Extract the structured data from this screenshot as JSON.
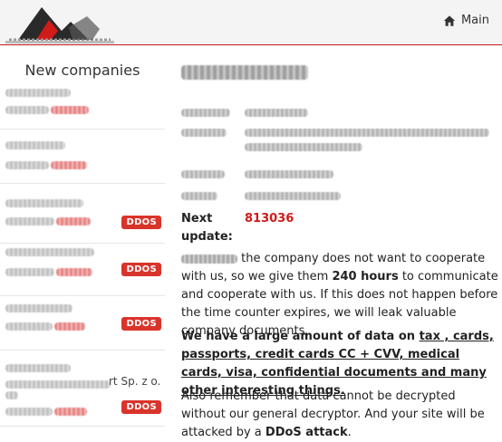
{
  "header": {
    "nav_main_label": "Main",
    "home_icon": "home-icon",
    "accent_color": "#c61a1a"
  },
  "sidebar": {
    "title": "New companies",
    "items": [
      {
        "ddos": false
      },
      {
        "ddos": false
      },
      {
        "ddos": true,
        "badge": "DDOS"
      },
      {
        "ddos": true,
        "badge": "DDOS"
      },
      {
        "ddos": true,
        "badge": "DDOS"
      },
      {
        "ddos": true,
        "badge": "DDOS",
        "tail_text": "rt Sp. z o."
      }
    ]
  },
  "main": {
    "next_update_label": "Next update:",
    "next_update_value": "813036",
    "paragraph1_part1": " the company does not want to cooperate with us, so we give them ",
    "paragraph1_hours": "240 hours",
    "paragraph1_part2": " to communicate and cooperate with us. If this does not happen before the time counter expires, we will leak valuable company documents.",
    "paragraph2_lead": "We have a large amount of data on ",
    "paragraph2_list": "tax , cards, passports, credit cards CC + CVV, medical cards, visa, confidential documents and many other interesting things.",
    "paragraph3_part1": "Also remember that data cannot be decrypted without our general decryptor. And your site will be attacked by a ",
    "paragraph3_ddos": "DDoS attack",
    "paragraph3_end": ".",
    "highlight_color": "#d11a1a"
  }
}
